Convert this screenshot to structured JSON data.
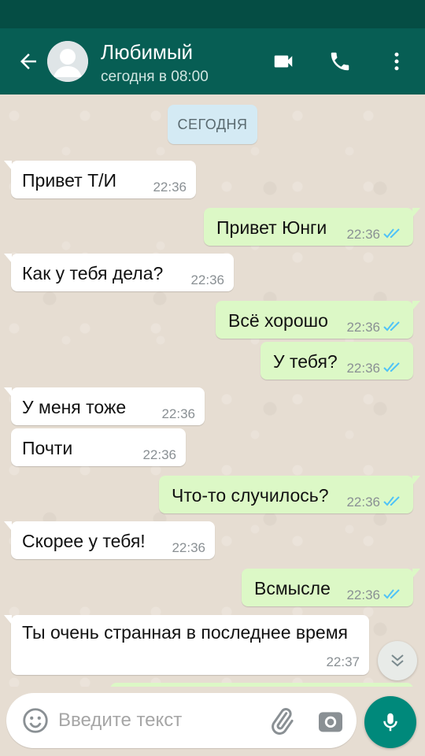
{
  "header": {
    "contact_name": "Любимый",
    "contact_status": "сегодня в 08:00",
    "icons": {
      "back": "arrow-back-icon",
      "video": "videocam-icon",
      "call": "phone-icon",
      "menu": "more-vert-icon"
    }
  },
  "chat": {
    "date_label": "СЕГОДНЯ",
    "messages": [
      {
        "direction": "incoming",
        "text": "Привет Т/И",
        "time": "22:36"
      },
      {
        "direction": "outgoing",
        "text": "Привет Юнги",
        "time": "22:36",
        "status": "read"
      },
      {
        "direction": "incoming",
        "text": "Как у тебя дела?",
        "time": "22:36"
      },
      {
        "direction": "outgoing",
        "text": "Всё хорошо",
        "time": "22:36",
        "status": "read"
      },
      {
        "direction": "outgoing",
        "text": "У тебя?",
        "time": "22:36",
        "status": "read"
      },
      {
        "direction": "incoming",
        "text": "У меня тоже",
        "time": "22:36"
      },
      {
        "direction": "incoming",
        "text": "Почти",
        "time": "22:36"
      },
      {
        "direction": "outgoing",
        "text": "Что-то случилось?",
        "time": "22:36",
        "status": "read"
      },
      {
        "direction": "incoming",
        "text": "Скорее у тебя!",
        "time": "22:36"
      },
      {
        "direction": "outgoing",
        "text": "Всмысле",
        "time": "22:36",
        "status": "read"
      },
      {
        "direction": "incoming",
        "text": "Ты очень странная в последнее время",
        "time": "22:37"
      }
    ]
  },
  "composer": {
    "placeholder": "Введите текст",
    "icons": {
      "emoji": "emoji-icon",
      "attach": "paperclip-icon",
      "camera": "camera-icon",
      "mic": "mic-icon"
    }
  },
  "colors": {
    "header_bg": "#075e54",
    "statusbar_bg": "#054d44",
    "incoming_bubble": "#ffffff",
    "outgoing_bubble": "#dcf8c6",
    "read_ticks": "#4fc3f7",
    "accent": "#00897b"
  }
}
